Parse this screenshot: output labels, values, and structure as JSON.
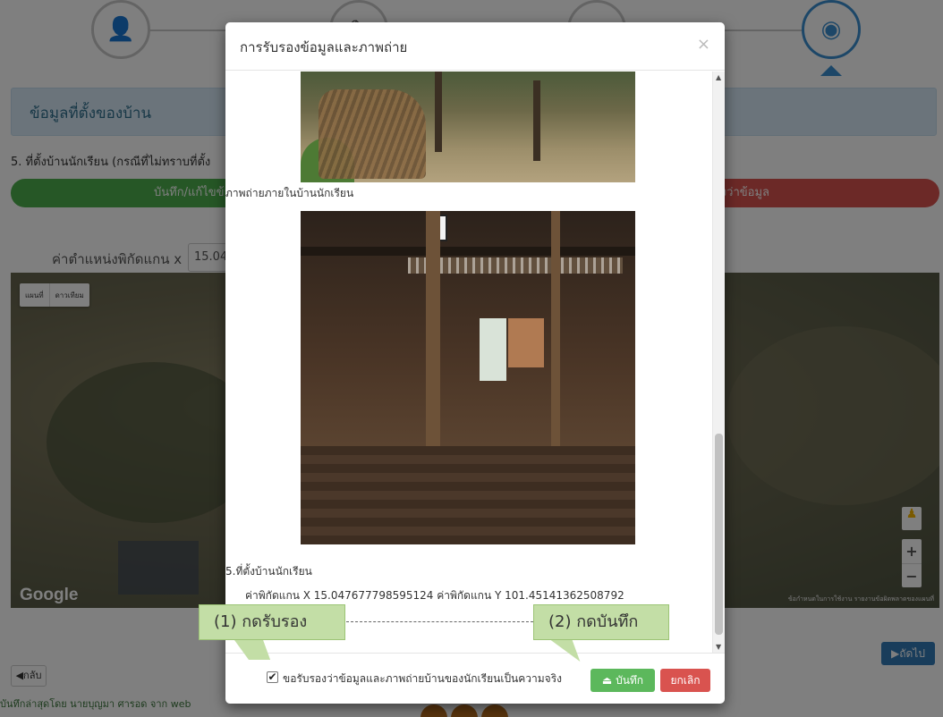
{
  "background": {
    "steps": [
      {
        "icon": "user-icon",
        "glyph": "👤"
      },
      {
        "icon": "pencil-icon",
        "glyph": "✎"
      },
      {
        "icon": "monitor-icon",
        "glyph": "▭"
      },
      {
        "icon": "map-marker-icon",
        "glyph": "◉"
      }
    ],
    "info_header": "ข้อมูลที่ตั้งของบ้าน",
    "section_5_label": "5.  ที่ตั้งบ้านนักเรียน   (กรณีที่ไม่ทราบที่ตั้ง",
    "green_bar_text": "บันทึก/แก้ไขข้อ",
    "red_bar_text": "องว่าข้อมูล",
    "coord_label": "ค่าตำแหน่งพิกัดแกน  x",
    "coord_input_value": "15.04",
    "map": {
      "toggle_map": "แผนที่",
      "toggle_satellite": "ดาวเทียม",
      "google_logo": "Google",
      "footer_text": "ข้อกำหนดในการใช้งาน   รายงานข้อผิดพลาดของแผนที่"
    },
    "back_label": "◀กลับ",
    "next_label": "▶ถัดไป",
    "saved_by": "บันทึกล่าสุดโดย นายบุญมา ศารอด จาก web"
  },
  "modal": {
    "title": "การรับรองข้อมูลและภาพถ่าย",
    "close_glyph": "×",
    "photo1_caption": "ภาพถ่ายภายในบ้านนักเรียน",
    "location_heading": "5.ที่ตั้งบ้านนักเรียน",
    "location_coords": "ค่าพิกัดแกน X 15.047677798595124 ค่าพิกัดแกน Y 101.45141362508792",
    "confirm_checked": true,
    "confirm_label": "ขอรับรองว่าข้อมูลและภาพถ่ายบ้านของนักเรียนเป็นความจริง",
    "save_label": "⏏ บันทึก",
    "cancel_label": "ยกเลิก"
  },
  "annotations": {
    "callout1": "(1) กดรับรอง",
    "callout2": "(2) กดบันทึก"
  },
  "colors": {
    "primary_blue": "#3a8fd0",
    "success_green": "#5cb85c",
    "danger_red": "#d9534f",
    "callout_green": "#c3dea6"
  }
}
